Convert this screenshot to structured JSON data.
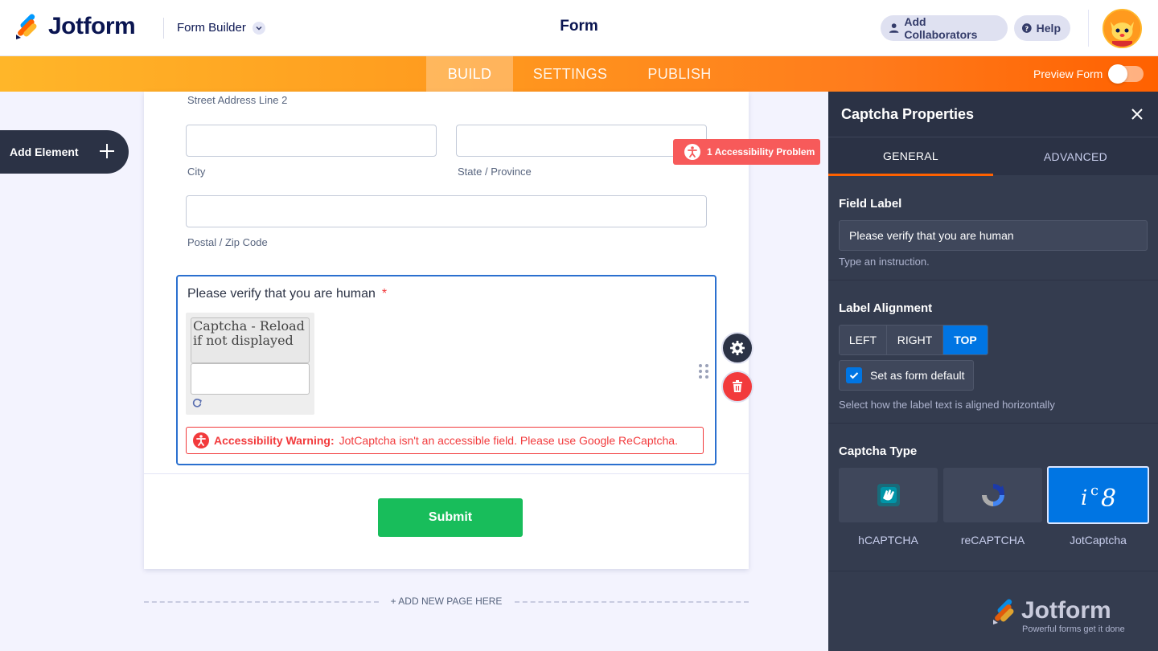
{
  "header": {
    "brand": "Jotform",
    "builder_menu": "Form Builder",
    "form_title": "Form",
    "add_collaborators": "Add Collaborators",
    "help": "Help"
  },
  "nav": {
    "tabs": [
      {
        "label": "BUILD",
        "active": true
      },
      {
        "label": "SETTINGS",
        "active": false
      },
      {
        "label": "PUBLISH",
        "active": false
      }
    ],
    "preview_label": "Preview Form",
    "preview_on": false
  },
  "sidebar": {
    "add_element": "Add Element"
  },
  "form": {
    "street2_label": "Street Address Line 2",
    "city_label": "City",
    "state_label": "State / Province",
    "zip_label": "Postal / Zip Code",
    "a11y_badge": "1 Accessibility Problem",
    "captcha_label": "Please verify that you are human",
    "required_mark": "*",
    "captcha_alt": "Captcha - Reload if not displayed",
    "warning_title": "Accessibility Warning:",
    "warning_text": "JotCaptcha isn't an accessible field. Please use Google ReCaptcha.",
    "submit": "Submit",
    "add_page": "+ ADD NEW PAGE HERE"
  },
  "panel": {
    "title": "Captcha Properties",
    "tabs": [
      {
        "label": "GENERAL",
        "active": true
      },
      {
        "label": "ADVANCED",
        "active": false
      }
    ],
    "field_label_title": "Field Label",
    "field_label_value": "Please verify that you are human",
    "field_label_hint": "Type an instruction.",
    "alignment_title": "Label Alignment",
    "alignment_options": [
      "LEFT",
      "RIGHT",
      "TOP"
    ],
    "alignment_selected": "TOP",
    "default_label": "Set as form default",
    "default_checked": true,
    "alignment_hint": "Select how the label text is aligned horizontally",
    "captcha_type_title": "Captcha Type",
    "captcha_types": [
      "hCAPTCHA",
      "reCAPTCHA",
      "JotCaptcha"
    ],
    "captcha_selected": "JotCaptcha",
    "brand": "Jotform",
    "tagline": "Powerful forms get it done"
  },
  "colors": {
    "accent_orange": "#ff6100",
    "accent_blue": "#0075e3",
    "error_red": "#f23a3c",
    "submit_green": "#18bd5b",
    "panel_bg": "#343c4f"
  }
}
